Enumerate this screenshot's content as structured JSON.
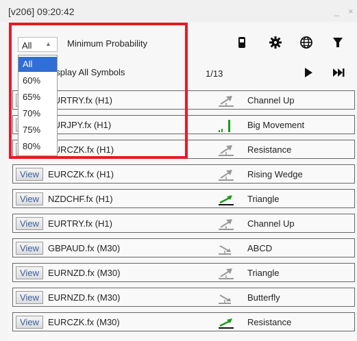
{
  "window": {
    "title": "[v206] 09:20:42",
    "minimize": "_",
    "close": "×"
  },
  "filter": {
    "selected": "All",
    "label": "Minimum Probability",
    "options": [
      "All",
      "60%",
      "65%",
      "70%",
      "75%",
      "80%"
    ]
  },
  "display": {
    "label": "Display All Symbols",
    "page": "1/13"
  },
  "toolbar": {
    "icons": [
      "phone-icon",
      "gear-icon",
      "globe-icon",
      "filter-icon"
    ],
    "controls": [
      "play-icon",
      "skip-end-icon"
    ]
  },
  "colors": {
    "accent": "#e41b25",
    "selection": "#2f6fd6",
    "link": "#3a5fa0",
    "green": "#1a9a1a"
  },
  "rows": [
    {
      "view": "View",
      "symbol": "EURTRY.fx (H1)",
      "pattern": "Channel Up",
      "icon": "up-arrow-icon"
    },
    {
      "view": "View",
      "symbol": "EURJPY.fx (H1)",
      "pattern": "Big Movement",
      "icon": "bar-chart-icon"
    },
    {
      "view": "View",
      "symbol": "EURCZK.fx (H1)",
      "pattern": "Resistance",
      "icon": "up-arrow-icon"
    },
    {
      "view": "View",
      "symbol": "EURCZK.fx (H1)",
      "pattern": "Rising Wedge",
      "icon": "up-arrow-icon"
    },
    {
      "view": "View",
      "symbol": "NZDCHF.fx (H1)",
      "pattern": "Triangle",
      "icon": "green-arrow-icon"
    },
    {
      "view": "View",
      "symbol": "EURTRY.fx (H1)",
      "pattern": "Channel Up",
      "icon": "up-arrow-icon"
    },
    {
      "view": "View",
      "symbol": "GBPAUD.fx (M30)",
      "pattern": "ABCD",
      "icon": "down-arrow-icon"
    },
    {
      "view": "View",
      "symbol": "EURNZD.fx (M30)",
      "pattern": "Triangle",
      "icon": "up-arrow-icon"
    },
    {
      "view": "View",
      "symbol": "EURNZD.fx (M30)",
      "pattern": "Butterfly",
      "icon": "down-arrow-icon"
    },
    {
      "view": "View",
      "symbol": "EURCZK.fx (M30)",
      "pattern": "Resistance",
      "icon": "green-arrow-icon"
    }
  ]
}
